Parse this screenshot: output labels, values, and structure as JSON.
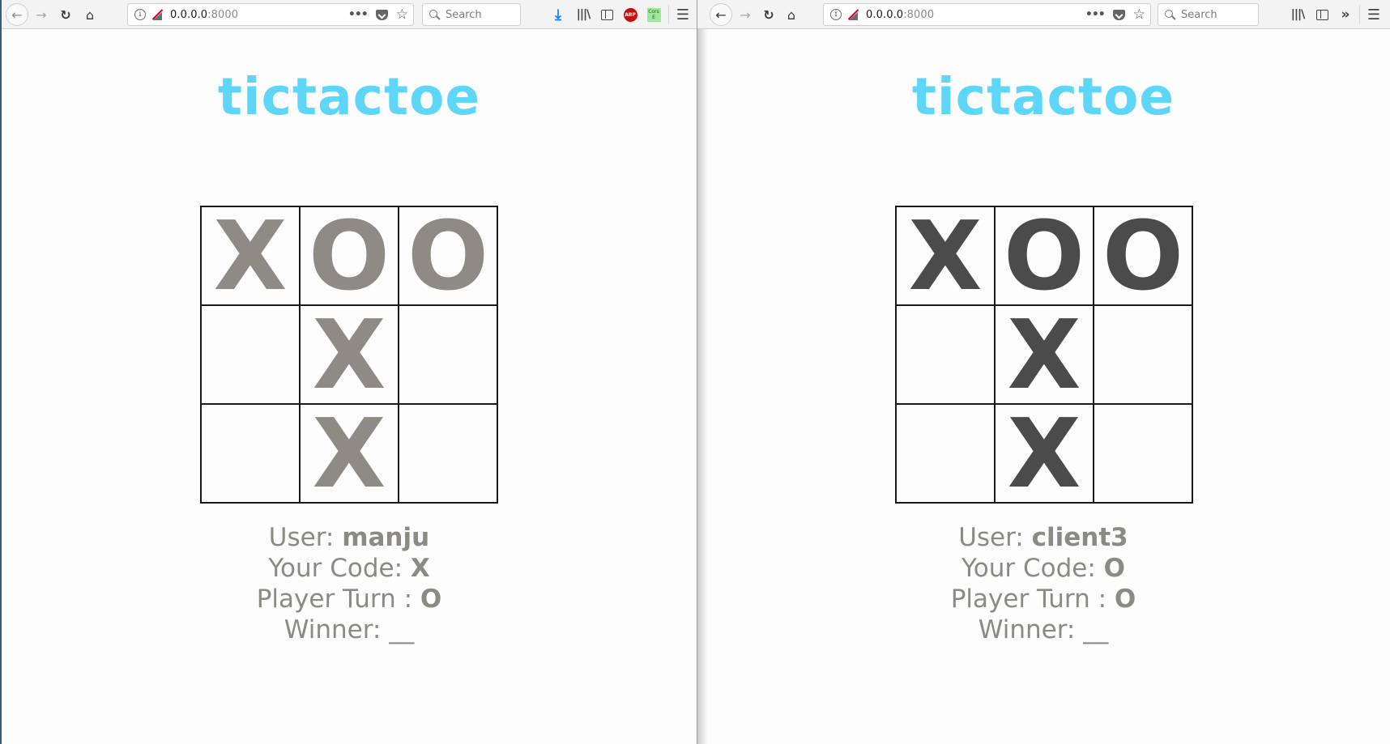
{
  "left_window": {
    "toolbar": {
      "url_host": "0.0.0.0",
      "url_port": ":8000",
      "search_placeholder": "Search",
      "cors_label": "Cors E",
      "abp_label": "ABP"
    },
    "page": {
      "title": "tictactoe",
      "board": [
        "X",
        "O",
        "O",
        "",
        "X",
        "",
        "",
        "X",
        ""
      ],
      "user_label": "User: ",
      "user_value": "manju",
      "code_label": "Your Code: ",
      "code_value": "X",
      "turn_label": "Player Turn : ",
      "turn_value": "O",
      "winner_label": "Winner: ",
      "winner_value": "__"
    }
  },
  "right_window": {
    "toolbar": {
      "url_host": "0.0.0.0",
      "url_port": ":8000",
      "search_placeholder": "Search"
    },
    "page": {
      "title": "tictactoe",
      "board": [
        "X",
        "O",
        "O",
        "",
        "X",
        "",
        "",
        "X",
        ""
      ],
      "user_label": "User: ",
      "user_value": "client3",
      "code_label": "Your Code: ",
      "code_value": "O",
      "turn_label": "Player Turn : ",
      "turn_value": "O",
      "winner_label": "Winner: ",
      "winner_value": "__"
    }
  },
  "colors": {
    "title": "#5dd6f9",
    "left_marks": "#8e8b85",
    "right_marks": "#4b4b4b",
    "info_text": "#8c8a84"
  }
}
